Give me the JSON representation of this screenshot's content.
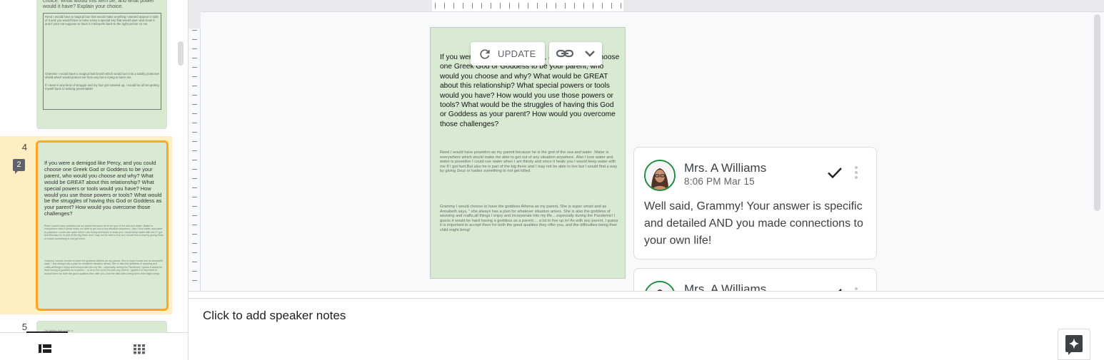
{
  "filmstrip": {
    "slide3": {
      "title_text": "choice.  What would this item be, and what power would it have?  Explain your choice.",
      "box_text_1": "Reed    I would have a magical box that would make anything I wanted appear in side of it and you would have to have a key a special key that would open and close it and if your not suppose to have it it teleports back to the right person so me",
      "box_text_2": "Grammie  I would have a magical hair brush which would turn into a totally protective shield which would protect me from any force trying to harm me",
      "box_text_3": "If I were in any kind of struggle and my hair got messed up, I would be all set getting myself back to looking presentable!"
    },
    "slide4": {
      "number": "4",
      "comment_count": "2",
      "question": "If you were a demigod like Percy, and you could choose one Greek God or Goddess to be your parent, who would you choose and why?  What would be GREAT about this relationship? What special powers or tools would you have?  How would you use those powers or tools? What would be the struggles of having this God or Goddess as your parent?  How would you overcome those challenges?",
      "answer_reed": "Reed        I would have poseidon as my parent because he is the god of the sea and water  .Water is everywhere which would make me able to get out of any situation anywhere  .Also I love water and water is poseidon I could use water when I am thirsty and since it heals you I would keep water with me If I got hurt.But also he is part of the big three and I may not be able to live but I would find a way by giving Zeus or hades something to not get killed.",
      "answer_grammy": "Grammy   I would choose to have the goddess Athena as my parent.  She is super smart and as Annabeth says, \" she always has a plan for whatever situation arises.  She is also the goddess of weaving and crafts,all things I enjoy and incorporate into my life....especially during the Pandemic! I guess it would be hard having a goddess as a parent.... a lot to live up to! As with any parent, I guess it is important to accept them for both the good qualities they offer you, and the difficulties being their child might bring!"
    },
    "slide5": {
      "number": "5",
      "snippet": "I'm willing, like a you a"
    }
  },
  "canvas": {
    "question": "If you were a demigod like Percy, and you could choose one Greek God or Goddess to be your parent, who would you choose and why?  What would be GREAT about this relationship? What special powers or tools would you have?  How would you use those powers or tools? What would be the struggles of having this God or Goddess as your parent?  How would you overcome those challenges?",
    "answer_reed": "Reed        I would have poseidon as my parent because he is the god of the sea and water  .Water is everywhere which would make me able to get out of any situation anywhere  .Also I love water and water is poseidon I could use water when I am thirsty and since it heals you I would keep water with me If I got hurt.But also he is part of the big three and I may not be able to live but I would find a way by giving Zeus or hades something to not get killed.",
    "answer_grammy": "Grammy   I would choose to have the goddess Athena as my parent.  She is super smart and as Annabeth says, \" she always has a plan for whatever situation arises.  She is also the goddess of weaving and crafts,all things I enjoy and incorporate into my life....especially during the Pandemic! I guess it would be hard having a goddess as a parent.... a lot to live up to! As with any parent, I guess it is important to accept them for both the good qualities they offer you, and the difficulties being their child might bring!",
    "update_label": "UPDATE"
  },
  "comments": [
    {
      "author": "Mrs. A Williams",
      "time": "8:06 PM Mar 15",
      "body": "Well said, Grammy!  Your answer is specific and detailed AND you made connections to your own life!"
    },
    {
      "author": "Mrs. A Williams",
      "time": "",
      "body": ""
    }
  ],
  "notes": {
    "placeholder": "Click to add speaker notes"
  },
  "icons": {
    "update": "refresh-icon",
    "link": "link-icon",
    "link_options": "chevron-down-icon",
    "resolve": "checkmark-icon",
    "more": "more-vert-icon",
    "filmstrip_view": "filmstrip-view-icon",
    "grid_view": "grid-view-icon",
    "gemini": "sparkle-icon"
  },
  "colors": {
    "slide_bg": "#d9ead3",
    "selected_row": "#feefc3",
    "selected_border": "#f9a825",
    "avatar_ring": "#1e8e3e"
  }
}
